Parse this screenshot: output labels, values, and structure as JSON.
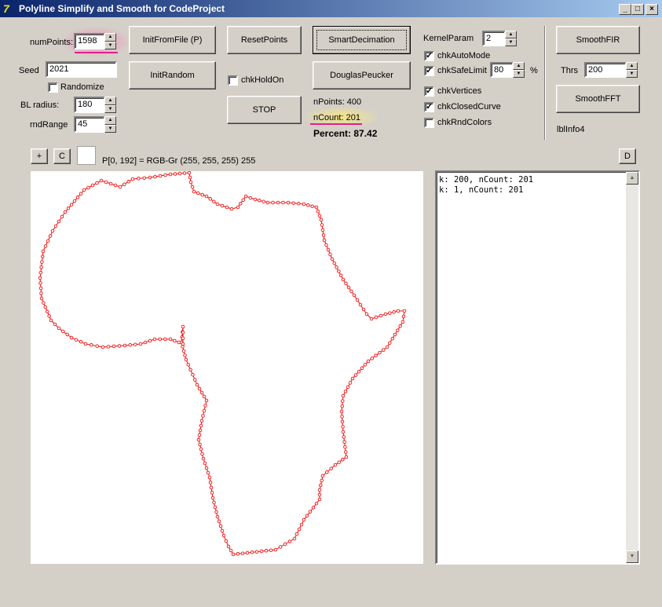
{
  "window": {
    "title": "Polyline Simplify and Smooth for CodeProject",
    "icon_name": "delphi-app-icon",
    "controls": [
      "_",
      "□",
      "×"
    ]
  },
  "params": {
    "num_points_label": "numPoints:",
    "num_points_value": "1598",
    "seed_label": "Seed",
    "seed_value": "2021",
    "randomize_label": "Randomize",
    "randomize_checked": false,
    "bl_radius_label": "BL radius:",
    "bl_radius_value": "180",
    "rnd_range_label": "rndRange",
    "rnd_range_value": "45"
  },
  "buttons": {
    "init_from_file": "InitFromFile (P)",
    "init_random": "InitRandom",
    "reset_points": "ResetPoints",
    "stop": "STOP",
    "smart_decimation": "SmartDecimation",
    "douglas_peucker": "DouglasPeucker",
    "smooth_fir": "SmoothFIR",
    "smooth_fft": "SmoothFFT",
    "plus": "+",
    "clear": "C",
    "d": "D"
  },
  "hold_on": {
    "label": "chkHoldOn",
    "checked": false
  },
  "stats": {
    "n_points": "nPoints: 400",
    "n_count": "nCount: 201",
    "percent": "Percent: 87.42"
  },
  "kernel": {
    "label": "KernelParam",
    "value": "2",
    "auto_mode_label": "chkAutoMode",
    "auto_mode_checked": true,
    "safe_limit_label": "chkSafeLimit",
    "safe_limit_checked": true,
    "safe_limit_value": "80",
    "percent_sign": "%",
    "vertices_label": "chkVertices",
    "vertices_checked": true,
    "closed_curve_label": "chkClosedCurve",
    "closed_curve_checked": true,
    "rnd_colors_label": "chkRndColors",
    "rnd_colors_checked": false
  },
  "smooth": {
    "thrs_label": "Thrs",
    "thrs_value": "200",
    "lbl_info": "lblInfo4"
  },
  "pixel_info": "P[0, 192] = RGB-Gr (255, 255, 255) 255",
  "memo_lines": "k: 200, nCount: 201\nk: 1, nCount: 201",
  "colors": {
    "polyline": "#ee1111",
    "highlight_pink": "#ff78be",
    "highlight_yellow": "#ffeb78",
    "underline": "#e0208a"
  }
}
